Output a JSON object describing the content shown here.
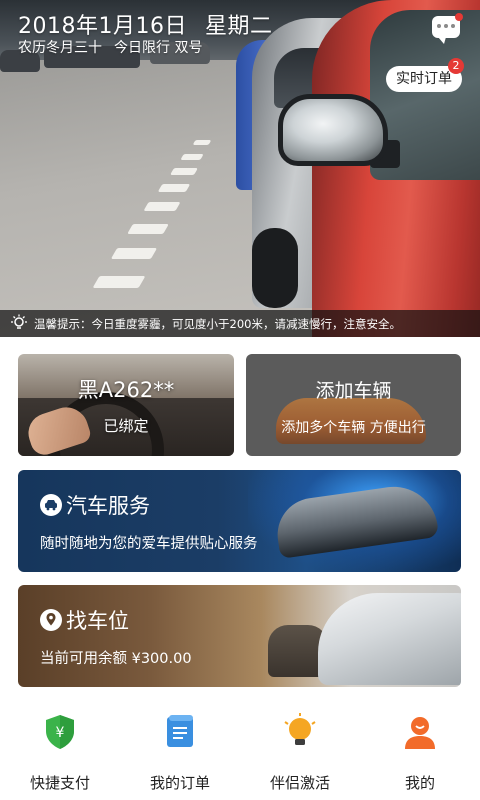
{
  "header": {
    "date": "2018年1月16日",
    "weekday": "星期二",
    "lunar": "农历冬月三十",
    "restriction": "今日限行 双号"
  },
  "realtime_orders": {
    "label": "实时订单",
    "badge": "2"
  },
  "notice": {
    "text": "温馨提示：今日重度雾霾，可见度小于200米，请减速慢行，注意安全。"
  },
  "cards": {
    "my_car": {
      "plate": "黑A262**",
      "status": "已绑定"
    },
    "add_car": {
      "title": "添加车辆",
      "subtitle": "添加多个车辆  方便出行"
    },
    "service": {
      "title": "汽车服务",
      "subtitle": "随时随地为您的爱车提供贴心服务"
    },
    "parking": {
      "title": "找车位",
      "subtitle": "当前可用余额 ¥300.00"
    }
  },
  "nav": {
    "items": [
      {
        "label": "快捷支付",
        "icon": "shield-yen-icon"
      },
      {
        "label": "我的订单",
        "icon": "scroll-order-icon"
      },
      {
        "label": "伴侣激活",
        "icon": "lightbulb-icon"
      },
      {
        "label": "我的",
        "icon": "user-avatar-icon"
      }
    ]
  },
  "colors": {
    "accent_red": "#e53935",
    "service_blue": "#1b3d66",
    "pay_green": "#3bb34a",
    "order_blue": "#3a8fe0",
    "bulb_orange": "#f5a623",
    "user_orange": "#f26b2a"
  }
}
